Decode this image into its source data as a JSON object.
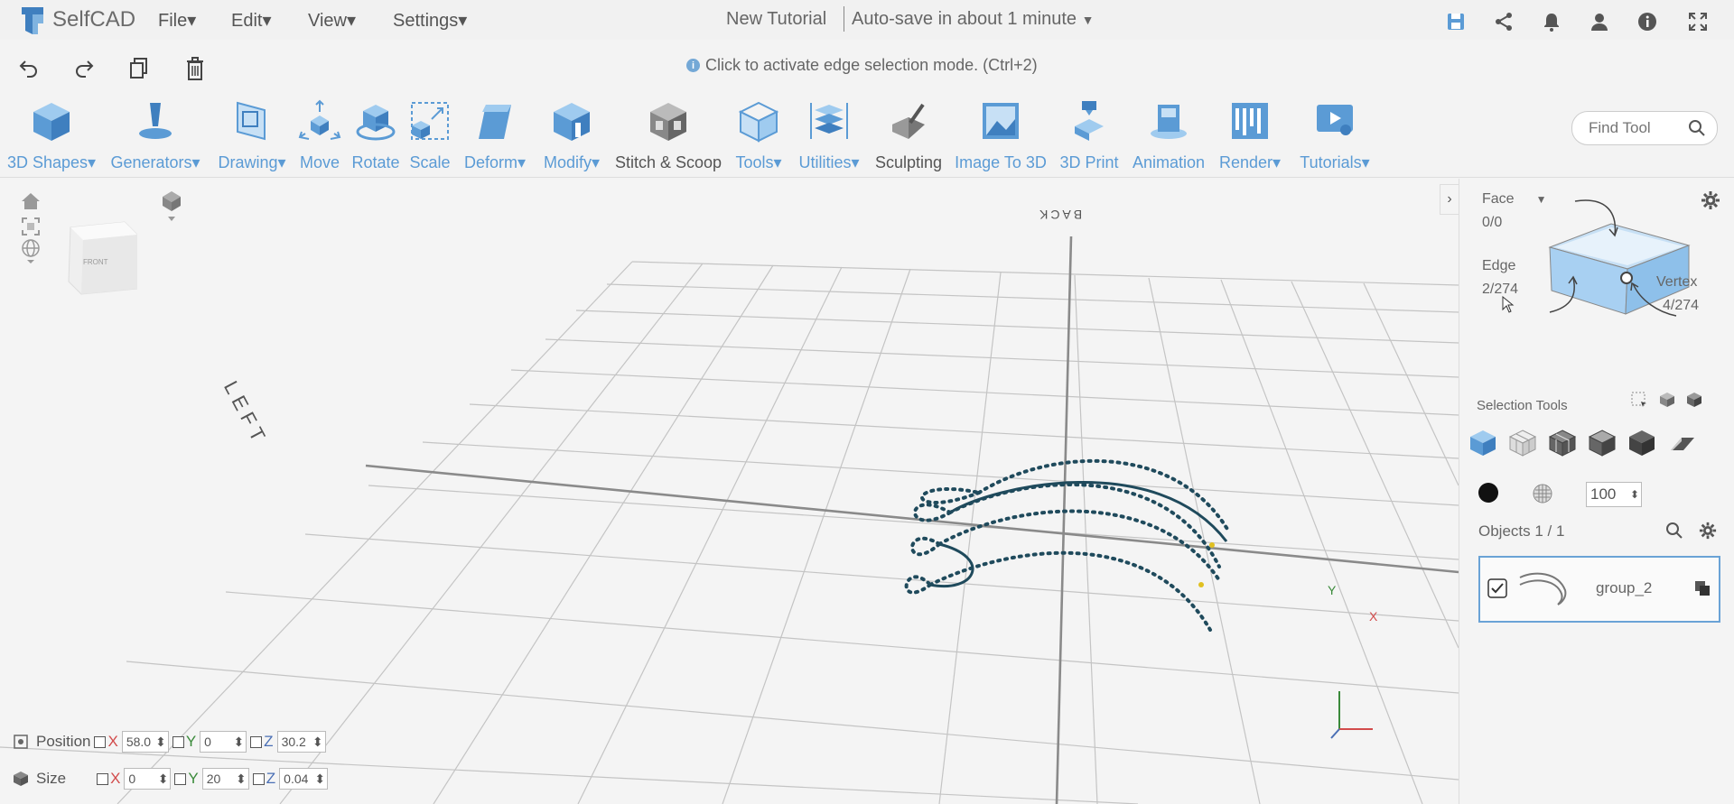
{
  "app": {
    "logo_text": "SelfCAD",
    "title": "New Tutorial",
    "autosave": "Auto-save in about 1 minute"
  },
  "menu": [
    "File",
    "Edit",
    "View",
    "Settings"
  ],
  "hint": "Click to activate edge selection mode. (Ctrl+2)",
  "tools": [
    {
      "label": "3D Shapes",
      "dropdown": true
    },
    {
      "label": "Generators",
      "dropdown": true
    },
    {
      "label": "Drawing",
      "dropdown": true
    },
    {
      "label": "Move",
      "dropdown": false
    },
    {
      "label": "Rotate",
      "dropdown": false
    },
    {
      "label": "Scale",
      "dropdown": false
    },
    {
      "label": "Deform",
      "dropdown": true
    },
    {
      "label": "Modify",
      "dropdown": true
    },
    {
      "label": "Stitch & Scoop",
      "dropdown": false
    },
    {
      "label": "Tools",
      "dropdown": true
    },
    {
      "label": "Utilities",
      "dropdown": true
    },
    {
      "label": "Sculpting",
      "dropdown": false
    },
    {
      "label": "Image To 3D",
      "dropdown": false
    },
    {
      "label": "3D Print",
      "dropdown": false
    },
    {
      "label": "Animation",
      "dropdown": false
    },
    {
      "label": "Render",
      "dropdown": true
    },
    {
      "label": "Tutorials",
      "dropdown": true
    }
  ],
  "find_tool": {
    "placeholder": "Find Tool"
  },
  "viewport": {
    "label_back": "BACK",
    "label_left": "LEFT",
    "cube_label": "FRONT",
    "axis": {
      "x": "X",
      "y": "Y"
    }
  },
  "selection": {
    "face_label": "Face",
    "face_count": "0/0",
    "edge_label": "Edge",
    "edge_count": "2/274",
    "vertex_label": "Vertex",
    "vertex_count": "4/274",
    "tools_label": "Selection Tools",
    "brush_size": "100"
  },
  "objects": {
    "label": "Objects 1 / 1",
    "items": [
      {
        "name": "group_2",
        "checked": true
      }
    ]
  },
  "transform": {
    "position_label": "Position",
    "size_label": "Size",
    "position": {
      "x": "58.0",
      "y": "0",
      "z": "30.2"
    },
    "size": {
      "x": "0",
      "y": "20",
      "z": "0.04"
    }
  },
  "colors": {
    "accent": "#5b9bd5",
    "curve": "#1f4a5c"
  }
}
